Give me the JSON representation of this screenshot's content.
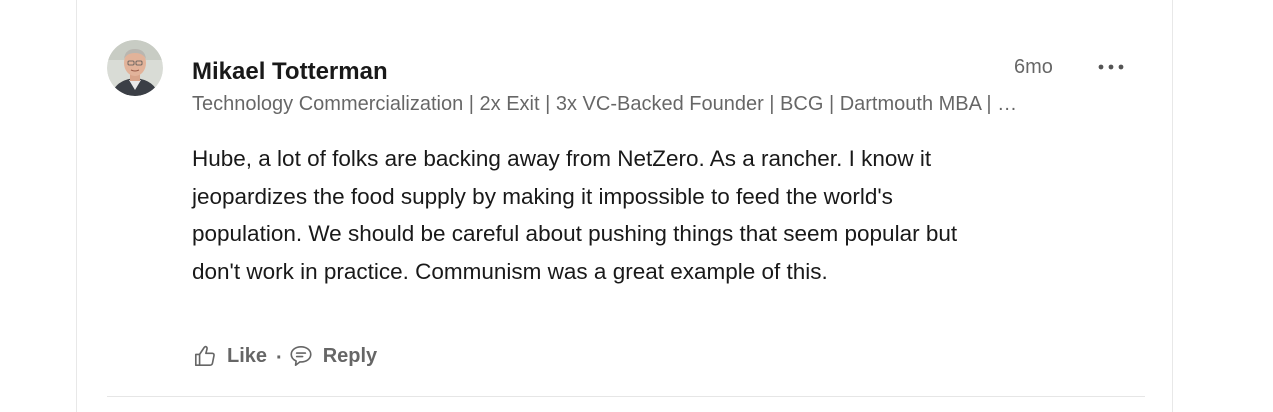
{
  "comment": {
    "author": {
      "name": "Mikael Totterman",
      "headline": "Technology Commercialization | 2x Exit | 3x VC-Backed Founder | BCG | Dartmouth MBA | …",
      "avatar_icon": "profile-photo"
    },
    "timestamp": "6mo",
    "more_icon": "ellipsis-icon",
    "text_lines": [
      "Hube, a lot of folks are backing away from NetZero. As a rancher. I know it",
      "jeopardizes the food supply by making it impossible to feed the world's",
      "population. We should be careful about pushing things that seem popular but",
      "don't work in practice. Communism was a great example of this."
    ],
    "actions": {
      "like_label": "Like",
      "separator": "·",
      "reply_label": "Reply",
      "like_icon": "thumbs-up-icon",
      "reply_icon": "speech-bubble-icon"
    }
  },
  "colors": {
    "primary_text": "#1a1a1a",
    "secondary_text": "#666666",
    "border": "#e8e8e8"
  }
}
